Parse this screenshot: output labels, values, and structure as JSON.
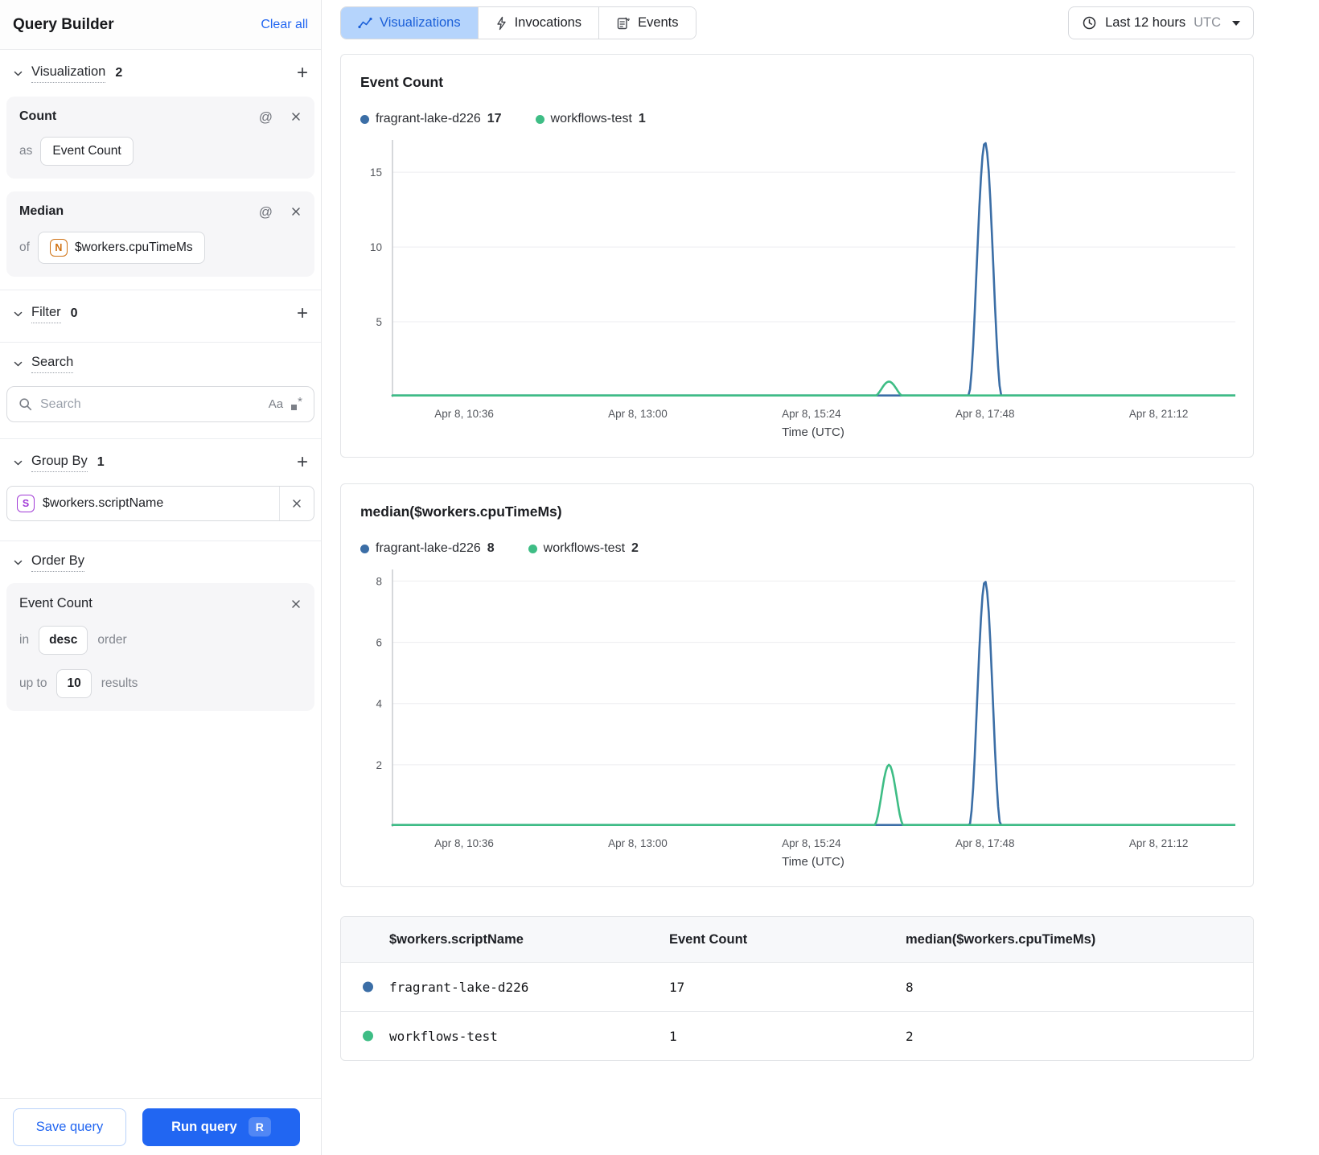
{
  "sidebar": {
    "title": "Query Builder",
    "clear_all_label": "Clear all",
    "visualization": {
      "label": "Visualization",
      "count": "2",
      "count_card": {
        "title": "Count",
        "as_label": "as",
        "value": "Event Count"
      },
      "median_card": {
        "title": "Median",
        "of_label": "of",
        "field_type_icon": "N",
        "field": "$workers.cpuTimeMs"
      }
    },
    "filter": {
      "label": "Filter",
      "count": "0"
    },
    "search": {
      "label": "Search",
      "placeholder": "Search",
      "case_toggle": "Aa"
    },
    "group_by": {
      "label": "Group By",
      "count": "1",
      "item": {
        "field_type_icon": "S",
        "field": "$workers.scriptName"
      }
    },
    "order_by": {
      "label": "Order By",
      "card": {
        "title": "Event Count",
        "in_label": "in",
        "direction": "desc",
        "order_label": "order",
        "up_to_label": "up to",
        "limit": "10",
        "results_label": "results"
      }
    },
    "footer": {
      "save_label": "Save query",
      "run_label": "Run query",
      "run_shortcut": "R"
    }
  },
  "toolbar": {
    "tabs": [
      {
        "label": "Visualizations"
      },
      {
        "label": "Invocations"
      },
      {
        "label": "Events"
      }
    ],
    "time_range": {
      "value": "Last 12 hours",
      "timezone": "UTC"
    }
  },
  "chart_data": [
    {
      "type": "line",
      "title": "Event Count",
      "xlabel": "Time (UTC)",
      "ylim": [
        0,
        17
      ],
      "ymax": 17,
      "y_ticks": [
        5,
        10,
        15
      ],
      "x_ticks": [
        {
          "label": "Apr 8, 10:36",
          "pos": 0.085
        },
        {
          "label": "Apr 8, 13:00",
          "pos": 0.291
        },
        {
          "label": "Apr 8, 15:24",
          "pos": 0.497
        },
        {
          "label": "Apr 8, 17:48",
          "pos": 0.703
        },
        {
          "label": "Apr 8, 21:12",
          "pos": 0.909
        }
      ],
      "grid": true,
      "legend_position": "top",
      "series": [
        {
          "name": "fragrant-lake-d226",
          "legend_value": "17",
          "color": "#3b6ea6",
          "baseline": 0,
          "peaks": [
            {
              "center": 0.703,
              "half_width": 0.02,
              "height": 17
            }
          ]
        },
        {
          "name": "workflows-test",
          "legend_value": "1",
          "color": "#3ebd85",
          "baseline": 0,
          "peaks": [
            {
              "center": 0.589,
              "half_width": 0.018,
              "height": 1
            }
          ]
        }
      ]
    },
    {
      "type": "line",
      "title": "median($workers.cpuTimeMs)",
      "xlabel": "Time (UTC)",
      "ylim": [
        0,
        8.3
      ],
      "ymax": 8.3,
      "y_ticks": [
        2,
        4,
        6,
        8
      ],
      "x_ticks": [
        {
          "label": "Apr 8, 10:36",
          "pos": 0.085
        },
        {
          "label": "Apr 8, 13:00",
          "pos": 0.291
        },
        {
          "label": "Apr 8, 15:24",
          "pos": 0.497
        },
        {
          "label": "Apr 8, 17:48",
          "pos": 0.703
        },
        {
          "label": "Apr 8, 21:12",
          "pos": 0.909
        }
      ],
      "grid": true,
      "legend_position": "top",
      "series": [
        {
          "name": "fragrant-lake-d226",
          "legend_value": "8",
          "color": "#3b6ea6",
          "baseline": 0,
          "peaks": [
            {
              "center": 0.703,
              "half_width": 0.019,
              "height": 8
            }
          ]
        },
        {
          "name": "workflows-test",
          "legend_value": "2",
          "color": "#3ebd85",
          "baseline": 0,
          "peaks": [
            {
              "center": 0.589,
              "half_width": 0.018,
              "height": 2
            }
          ]
        }
      ]
    }
  ],
  "table": {
    "columns": [
      "$workers.scriptName",
      "Event Count",
      "median($workers.cpuTimeMs)"
    ],
    "rows": [
      {
        "dot_color": "#3b6ea6",
        "script_name": "fragrant-lake-d226",
        "event_count": "17",
        "median": "8"
      },
      {
        "dot_color": "#3ebd85",
        "script_name": "workflows-test",
        "event_count": "1",
        "median": "2"
      }
    ]
  }
}
